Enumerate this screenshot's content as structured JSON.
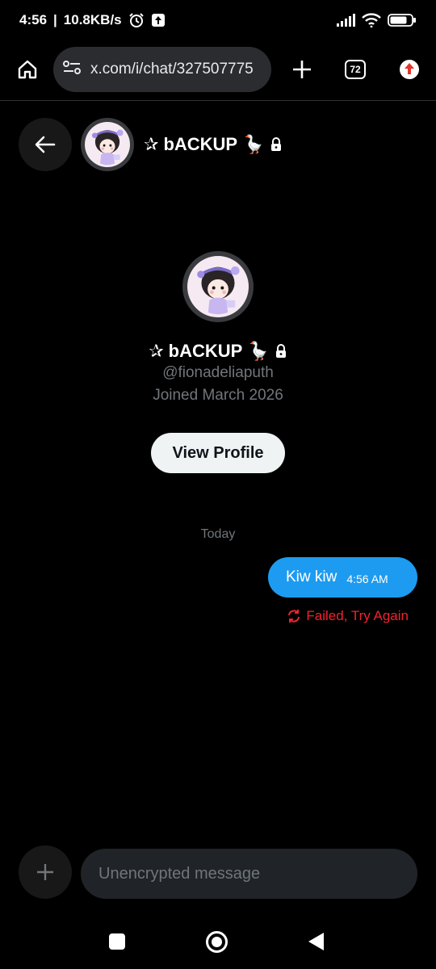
{
  "status_bar": {
    "time": "4:56",
    "speed": "10.8KB/s",
    "battery": "77"
  },
  "browser": {
    "url": "x.com/i/chat/327507775",
    "tab_count": "72"
  },
  "chat_header": {
    "name": "bACKUP",
    "prefix_glyph": "✰",
    "emoji": "🪿"
  },
  "profile": {
    "name": "bACKUP",
    "prefix_glyph": "✰",
    "emoji": "🪿",
    "handle": "@fionadeliaputh",
    "joined": "Joined March 2026",
    "view_profile_label": "View Profile"
  },
  "messages": {
    "date_separator": "Today",
    "items": [
      {
        "text": "Kiw kiw",
        "time": "4:56 AM",
        "status": "Failed, Try Again"
      }
    ]
  },
  "composer": {
    "placeholder": "Unencrypted message"
  },
  "colors": {
    "accent": "#1d9bf0",
    "error": "#f4212e",
    "background": "#000000"
  },
  "icons": [
    "home-icon",
    "site-settings-icon",
    "plus-icon",
    "tabs-icon",
    "update-icon",
    "back-arrow-icon",
    "lock-icon",
    "retry-icon",
    "add-icon"
  ]
}
